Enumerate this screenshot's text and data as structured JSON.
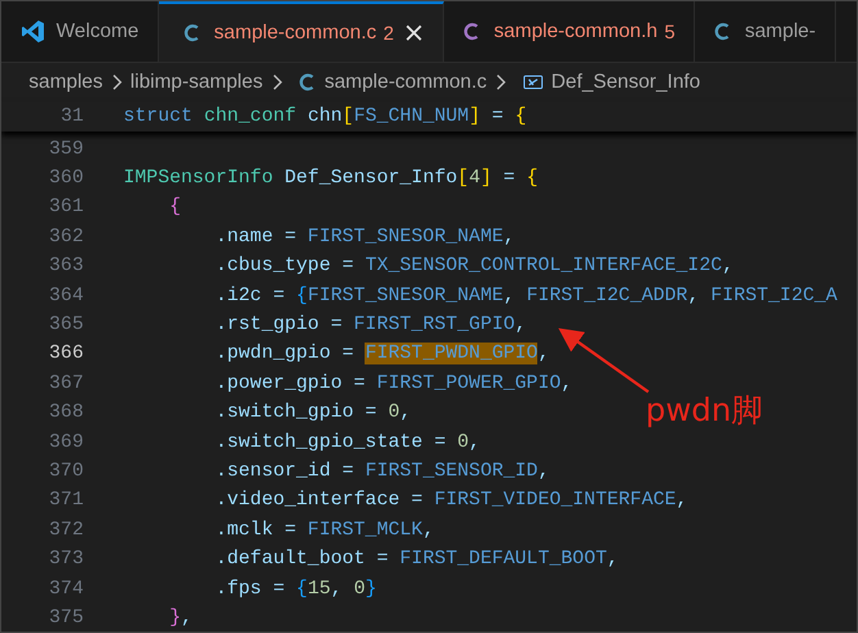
{
  "tabs": [
    {
      "label": "Welcome",
      "kind": "welcome",
      "selected": false,
      "error": false
    },
    {
      "label": "sample-common.c",
      "kind": "c",
      "badge": "2",
      "selected": true,
      "error": true
    },
    {
      "label": "sample-common.h",
      "kind": "h",
      "badge": "5",
      "selected": false,
      "error": true
    },
    {
      "label": "sample-",
      "kind": "c",
      "selected": false,
      "error": false
    }
  ],
  "breadcrumbs": [
    {
      "text": "samples",
      "kind": "folder"
    },
    {
      "text": "libimp-samples",
      "kind": "folder"
    },
    {
      "text": "sample-common.c",
      "kind": "file"
    },
    {
      "text": "Def_Sensor_Info",
      "kind": "symbol"
    }
  ],
  "sticky_line": {
    "number": "31",
    "current": false,
    "tokens": [
      {
        "text": "struct ",
        "kind": "keyword"
      },
      {
        "text": "chn_conf ",
        "kind": "type"
      },
      {
        "text": "chn",
        "kind": "variable"
      },
      {
        "text": "[",
        "kind": "bracket1"
      },
      {
        "text": "FS_CHN_NUM",
        "kind": "macro"
      },
      {
        "text": "]",
        "kind": "bracket1"
      },
      {
        "text": " = ",
        "kind": "plain"
      },
      {
        "text": "{",
        "kind": "bracket1"
      }
    ]
  },
  "lines": [
    {
      "number": "359",
      "current": false
    },
    {
      "number": "360",
      "current": false,
      "tokens": [
        {
          "text": "IMPSensorInfo ",
          "kind": "type"
        },
        {
          "text": "Def_Sensor_Info",
          "kind": "variable"
        },
        {
          "text": "[",
          "kind": "bracket1"
        },
        {
          "text": "4",
          "kind": "number"
        },
        {
          "text": "]",
          "kind": "bracket1"
        },
        {
          "text": " = ",
          "kind": "plain"
        },
        {
          "text": "{",
          "kind": "bracket1"
        }
      ]
    },
    {
      "number": "361",
      "current": false,
      "tokens": [
        {
          "text": "    {",
          "kind": "bracket2"
        }
      ]
    },
    {
      "number": "362",
      "current": false,
      "tokens": [
        {
          "text": "        .name = ",
          "kind": "plain"
        },
        {
          "text": "FIRST_SNESOR_NAME",
          "kind": "macro"
        },
        {
          "text": ",",
          "kind": "plain"
        }
      ]
    },
    {
      "number": "363",
      "current": false,
      "tokens": [
        {
          "text": "        .cbus_type = ",
          "kind": "plain"
        },
        {
          "text": "TX_SENSOR_CONTROL_INTERFACE_I2C",
          "kind": "macro"
        },
        {
          "text": ",",
          "kind": "plain"
        }
      ]
    },
    {
      "number": "364",
      "current": false,
      "tokens": [
        {
          "text": "        .i2c = ",
          "kind": "plain"
        },
        {
          "text": "{",
          "kind": "bracket3"
        },
        {
          "text": "FIRST_SNESOR_NAME",
          "kind": "macro"
        },
        {
          "text": ", ",
          "kind": "plain"
        },
        {
          "text": "FIRST_I2C_ADDR",
          "kind": "macro"
        },
        {
          "text": ", ",
          "kind": "plain"
        },
        {
          "text": "FIRST_I2C_A",
          "kind": "macro"
        }
      ]
    },
    {
      "number": "365",
      "current": false,
      "tokens": [
        {
          "text": "        .rst_gpio = ",
          "kind": "plain"
        },
        {
          "text": "FIRST_RST_GPIO",
          "kind": "macro"
        },
        {
          "text": ",",
          "kind": "plain"
        }
      ]
    },
    {
      "number": "366",
      "current": true,
      "tokens": [
        {
          "text": "        .pwdn_gpio = ",
          "kind": "plain"
        },
        {
          "text": "FIRST_PWDN_GPIO",
          "kind": "match"
        },
        {
          "text": ",",
          "kind": "plain"
        }
      ]
    },
    {
      "number": "367",
      "current": false,
      "tokens": [
        {
          "text": "        .power_gpio = ",
          "kind": "plain"
        },
        {
          "text": "FIRST_POWER_GPIO",
          "kind": "macro"
        },
        {
          "text": ",",
          "kind": "plain"
        }
      ]
    },
    {
      "number": "368",
      "current": false,
      "tokens": [
        {
          "text": "        .switch_gpio = ",
          "kind": "plain"
        },
        {
          "text": "0",
          "kind": "number"
        },
        {
          "text": ",",
          "kind": "plain"
        }
      ]
    },
    {
      "number": "369",
      "current": false,
      "tokens": [
        {
          "text": "        .switch_gpio_state = ",
          "kind": "plain"
        },
        {
          "text": "0",
          "kind": "number"
        },
        {
          "text": ",",
          "kind": "plain"
        }
      ]
    },
    {
      "number": "370",
      "current": false,
      "tokens": [
        {
          "text": "        .sensor_id = ",
          "kind": "plain"
        },
        {
          "text": "FIRST_SENSOR_ID",
          "kind": "macro"
        },
        {
          "text": ",",
          "kind": "plain"
        }
      ]
    },
    {
      "number": "371",
      "current": false,
      "tokens": [
        {
          "text": "        .video_interface = ",
          "kind": "plain"
        },
        {
          "text": "FIRST_VIDEO_INTERFACE",
          "kind": "macro"
        },
        {
          "text": ",",
          "kind": "plain"
        }
      ]
    },
    {
      "number": "372",
      "current": false,
      "tokens": [
        {
          "text": "        .mclk = ",
          "kind": "plain"
        },
        {
          "text": "FIRST_MCLK",
          "kind": "macro"
        },
        {
          "text": ",",
          "kind": "plain"
        }
      ]
    },
    {
      "number": "373",
      "current": false,
      "tokens": [
        {
          "text": "        .default_boot = ",
          "kind": "plain"
        },
        {
          "text": "FIRST_DEFAULT_BOOT",
          "kind": "macro"
        },
        {
          "text": ",",
          "kind": "plain"
        }
      ]
    },
    {
      "number": "374",
      "current": false,
      "tokens": [
        {
          "text": "        .fps = ",
          "kind": "plain"
        },
        {
          "text": "{",
          "kind": "bracket3"
        },
        {
          "text": "15",
          "kind": "number"
        },
        {
          "text": ", ",
          "kind": "plain"
        },
        {
          "text": "0",
          "kind": "number"
        },
        {
          "text": "}",
          "kind": "bracket3"
        }
      ]
    },
    {
      "number": "375",
      "current": false,
      "tokens": [
        {
          "text": "    }",
          "kind": "bracket2"
        },
        {
          "text": ",",
          "kind": "plain"
        }
      ]
    }
  ],
  "annotation": {
    "text": "pwdn脚"
  }
}
